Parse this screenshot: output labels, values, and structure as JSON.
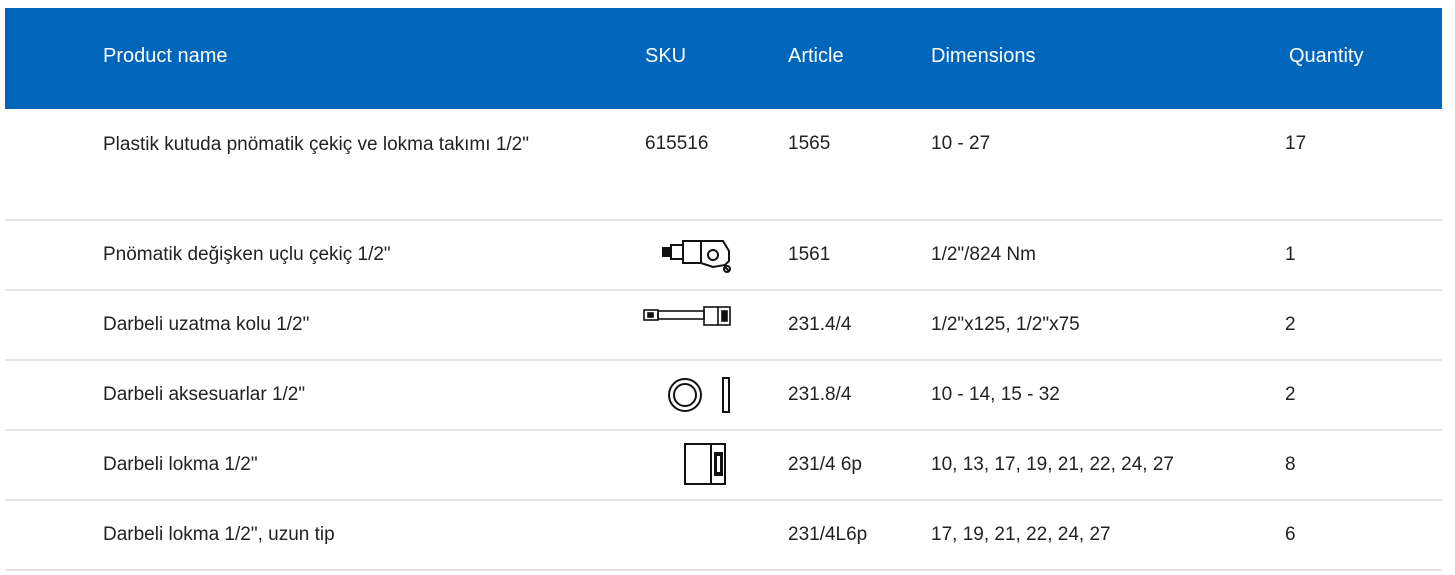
{
  "header": {
    "product_name": "Product name",
    "sku": "SKU",
    "article": "Article",
    "dimensions": "Dimensions",
    "quantity": "Quantity"
  },
  "rows": [
    {
      "name": "Plastik kutuda pnömatik çekiç ve lokma takımı 1/2\"",
      "sku": "615516",
      "sku_icon": null,
      "article": "1565",
      "dimensions": "10 - 27",
      "quantity": "17"
    },
    {
      "name": "Pnömatik değişken uçlu çekiç 1/2\"",
      "sku": "",
      "sku_icon": "impact-wrench-icon",
      "article": "1561",
      "dimensions": "1/2\"/824 Nm",
      "quantity": "1"
    },
    {
      "name": "Darbeli uzatma kolu 1/2\"",
      "sku": "",
      "sku_icon": "extension-bar-icon",
      "article": "231.4/4",
      "dimensions": "1/2\"x125, 1/2\"x75",
      "quantity": "2"
    },
    {
      "name": "Darbeli aksesuarlar 1/2\"",
      "sku": "",
      "sku_icon": "ring-and-pin-icon",
      "article": "231.8/4",
      "dimensions": "10 - 14, 15 - 32",
      "quantity": "2"
    },
    {
      "name": "Darbeli lokma 1/2\"",
      "sku": "",
      "sku_icon": "impact-socket-icon",
      "article": "231/4 6p",
      "dimensions": "10, 13, 17, 19, 21, 22, 24, 27",
      "quantity": "8"
    },
    {
      "name": "Darbeli lokma 1/2\", uzun tip",
      "sku": "",
      "sku_icon": null,
      "article": "231/4L6p",
      "dimensions": "17, 19, 21, 22, 24, 27",
      "quantity": "6"
    }
  ],
  "colors": {
    "header_bg": "#0066bb",
    "header_text": "#ffffff",
    "row_divider": "#e5e5e5",
    "body_text": "#222222"
  }
}
